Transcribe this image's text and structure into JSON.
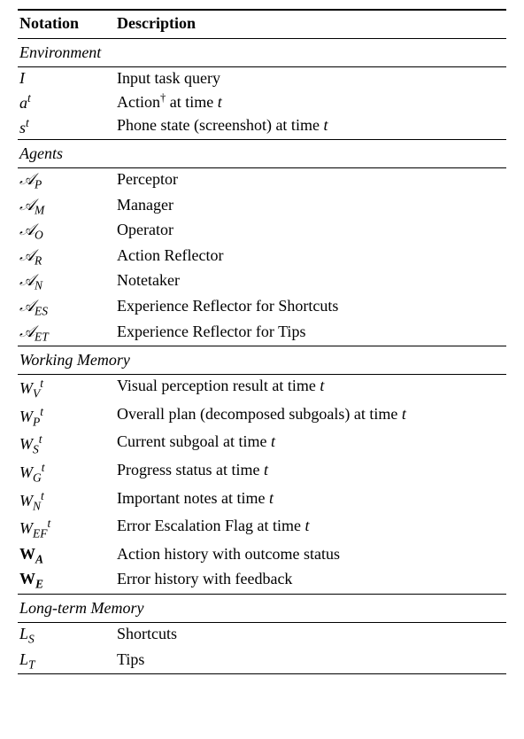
{
  "headers": {
    "notation": "Notation",
    "description": "Description"
  },
  "sections": [
    {
      "label": "Environment",
      "rows": [
        {
          "notation_html": "<span class='math'>I</span>",
          "description_html": "Input task query"
        },
        {
          "notation_html": "<span class='math'>a</span><sup>t</sup>",
          "description_html": "Action<span class='dagger'>†</span> at time <span class='t'>t</span>"
        },
        {
          "notation_html": "<span class='math'>s</span><sup>t</sup>",
          "description_html": "Phone state (screenshot) at time <span class='t'>t</span>"
        }
      ]
    },
    {
      "label": "Agents",
      "rows": [
        {
          "notation_html": "<span class='cal'>𝒜</span><sub>P</sub>",
          "description_html": "Perceptor"
        },
        {
          "notation_html": "<span class='cal'>𝒜</span><sub>M</sub>",
          "description_html": "Manager"
        },
        {
          "notation_html": "<span class='cal'>𝒜</span><sub>O</sub>",
          "description_html": "Operator"
        },
        {
          "notation_html": "<span class='cal'>𝒜</span><sub>R</sub>",
          "description_html": "Action Reflector"
        },
        {
          "notation_html": "<span class='cal'>𝒜</span><sub>N</sub>",
          "description_html": "Notetaker"
        },
        {
          "notation_html": "<span class='cal'>𝒜</span><sub>ES</sub>",
          "description_html": "Experience Reflector for Shortcuts"
        },
        {
          "notation_html": "<span class='cal'>𝒜</span><sub>ET</sub>",
          "description_html": "Experience Reflector for Tips"
        }
      ]
    },
    {
      "label": "Working Memory",
      "rows": [
        {
          "notation_html": "<span class='math'>W</span><sub>V</sub><sup>t</sup>",
          "description_html": "Visual perception result at time <span class='t'>t</span>"
        },
        {
          "notation_html": "<span class='math'>W</span><sub>P</sub><sup>t</sup>",
          "description_html": "Overall plan (decomposed subgoals) at time <span class='t'>t</span>"
        },
        {
          "notation_html": "<span class='math'>W</span><sub>S</sub><sup>t</sup>",
          "description_html": "Current subgoal at time <span class='t'>t</span>"
        },
        {
          "notation_html": "<span class='math'>W</span><sub>G</sub><sup>t</sup>",
          "description_html": "Progress status at time <span class='t'>t</span>"
        },
        {
          "notation_html": "<span class='math'>W</span><sub>N</sub><sup>t</sup>",
          "description_html": "Important notes at time <span class='t'>t</span>"
        },
        {
          "notation_html": "<span class='math'>W</span><sub>EF</sub><sup>t</sup>",
          "description_html": "Error Escalation Flag at time <span class='t'>t</span>"
        },
        {
          "notation_html": "<span class='bold'>W<sub>A</sub></span>",
          "description_html": "Action history with outcome status"
        },
        {
          "notation_html": "<span class='bold'>W<sub>E</sub></span>",
          "description_html": "Error history with feedback"
        }
      ]
    },
    {
      "label": "Long-term Memory",
      "rows": [
        {
          "notation_html": "<span class='math'>L</span><sub>S</sub>",
          "description_html": "Shortcuts"
        },
        {
          "notation_html": "<span class='math'>L</span><sub>T</sub>",
          "description_html": "Tips"
        }
      ]
    }
  ],
  "chart_data": {
    "type": "table",
    "title": "Notation Description Table",
    "columns": [
      "Notation",
      "Description"
    ],
    "sections": [
      {
        "name": "Environment",
        "rows": [
          [
            "I",
            "Input task query"
          ],
          [
            "a^t",
            "Action† at time t"
          ],
          [
            "s^t",
            "Phone state (screenshot) at time t"
          ]
        ]
      },
      {
        "name": "Agents",
        "rows": [
          [
            "A_P",
            "Perceptor"
          ],
          [
            "A_M",
            "Manager"
          ],
          [
            "A_O",
            "Operator"
          ],
          [
            "A_R",
            "Action Reflector"
          ],
          [
            "A_N",
            "Notetaker"
          ],
          [
            "A_ES",
            "Experience Reflector for Shortcuts"
          ],
          [
            "A_ET",
            "Experience Reflector for Tips"
          ]
        ]
      },
      {
        "name": "Working Memory",
        "rows": [
          [
            "W_V^t",
            "Visual perception result at time t"
          ],
          [
            "W_P^t",
            "Overall plan (decomposed subgoals) at time t"
          ],
          [
            "W_S^t",
            "Current subgoal at time t"
          ],
          [
            "W_G^t",
            "Progress status at time t"
          ],
          [
            "W_N^t",
            "Important notes at time t"
          ],
          [
            "W_EF^t",
            "Error Escalation Flag at time t"
          ],
          [
            "W_A (bold)",
            "Action history with outcome status"
          ],
          [
            "W_E (bold)",
            "Error history with feedback"
          ]
        ]
      },
      {
        "name": "Long-term Memory",
        "rows": [
          [
            "L_S",
            "Shortcuts"
          ],
          [
            "L_T",
            "Tips"
          ]
        ]
      }
    ]
  }
}
